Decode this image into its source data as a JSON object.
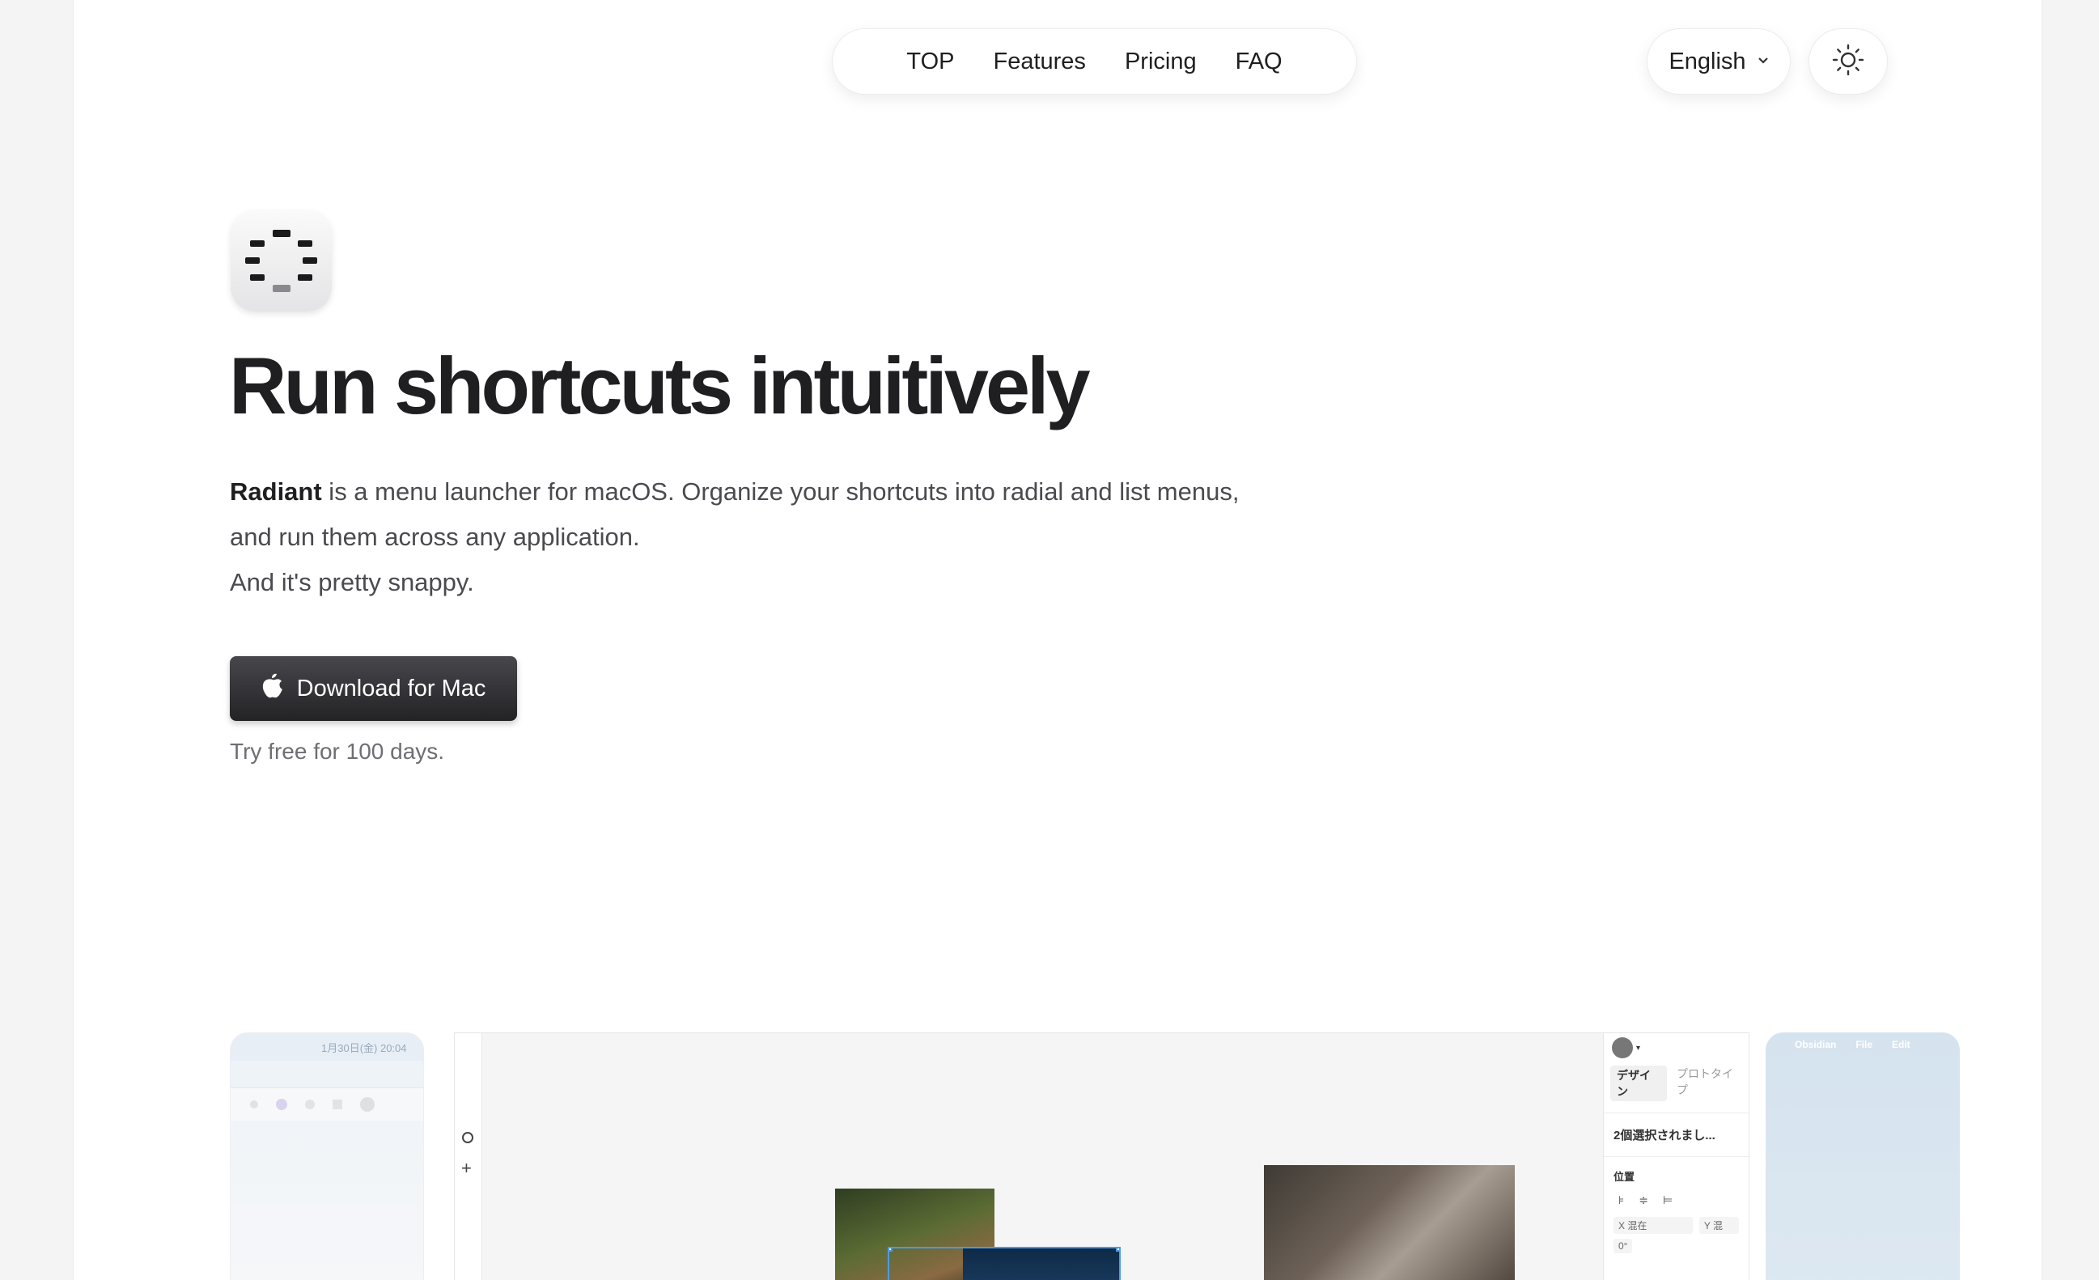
{
  "nav": {
    "items": [
      "TOP",
      "Features",
      "Pricing",
      "FAQ"
    ],
    "language": "English"
  },
  "hero": {
    "headline": "Run shortcuts intuitively",
    "brand": "Radiant",
    "desc_line1": " is a menu launcher for macOS. Organize your shortcuts into radial and list menus,",
    "desc_line2": "and run them across any application.",
    "desc_line3": "And it's pretty snappy.",
    "download_label": "Download for Mac",
    "trial_text": "Try free for 100 days."
  },
  "screenshot": {
    "phone_left_status": "1月30日(金) 20:04",
    "panel_tab_design": "デザイン",
    "panel_tab_prototype": "プロトタイプ",
    "panel_selection": "2個選択されまし...",
    "panel_position": "位置",
    "panel_x_label": "X",
    "panel_x_value": "混在",
    "panel_y_label": "Y",
    "panel_y_value": "混",
    "panel_rotation": "0°",
    "phone_right_app": "Obsidian",
    "phone_right_menu1": "File",
    "phone_right_menu2": "Edit"
  },
  "colors": {
    "accent_dark": "#2b2b2e",
    "selection_blue": "#4a9be8"
  },
  "icons": [
    "apple-icon",
    "sun-icon",
    "chevron-down-icon",
    "radiant-app-icon"
  ]
}
